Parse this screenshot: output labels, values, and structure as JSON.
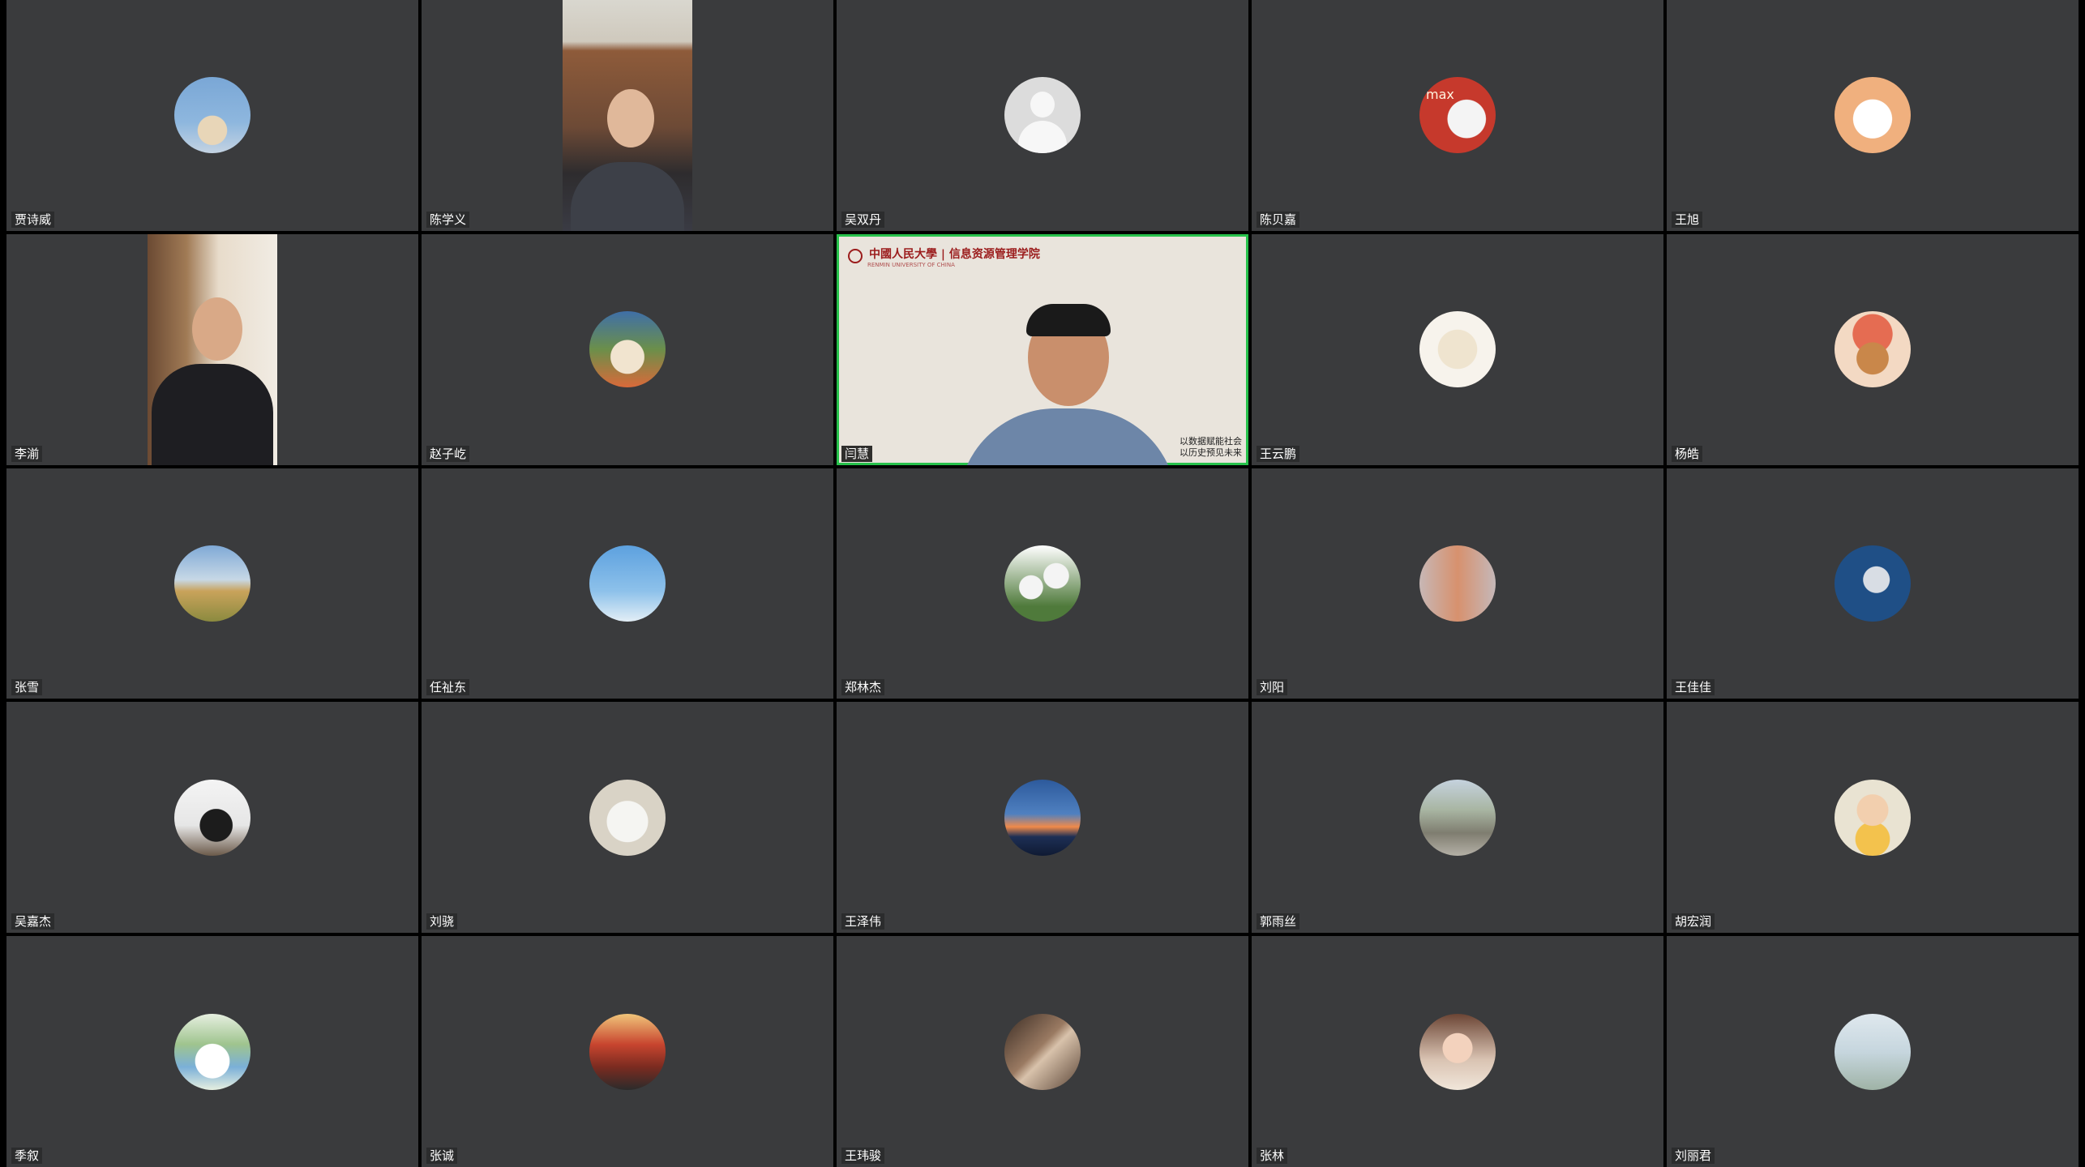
{
  "participants": [
    {
      "name": "贾诗威"
    },
    {
      "name": "陈学义"
    },
    {
      "name": "吴双丹"
    },
    {
      "name": "陈贝嘉"
    },
    {
      "name": "王旭"
    },
    {
      "name": "李湔"
    },
    {
      "name": "赵子屹"
    },
    {
      "name": "闫慧"
    },
    {
      "name": "王云鹏"
    },
    {
      "name": "杨皓"
    },
    {
      "name": "张雪"
    },
    {
      "name": "任祉东"
    },
    {
      "name": "郑林杰"
    },
    {
      "name": "刘阳"
    },
    {
      "name": "王佳佳"
    },
    {
      "name": "吴嘉杰"
    },
    {
      "name": "刘骁"
    },
    {
      "name": "王泽伟"
    },
    {
      "name": "郭雨丝"
    },
    {
      "name": "胡宏润"
    },
    {
      "name": "季叙"
    },
    {
      "name": "张诚"
    },
    {
      "name": "王玮骏"
    },
    {
      "name": "张林"
    },
    {
      "name": "刘丽君"
    }
  ],
  "avatar_text": "max",
  "banner": {
    "title": "中國人民大學 | 信息资源管理学院",
    "subtitle": "RENMIN UNIVERSITY OF CHINA",
    "slogan_line1": "以数据赋能社会",
    "slogan_line2": "以历史预见未来"
  },
  "colors": {
    "tile_bg": "#3a3b3d",
    "active_border": "#27c24c",
    "label_text": "#ffffff"
  }
}
